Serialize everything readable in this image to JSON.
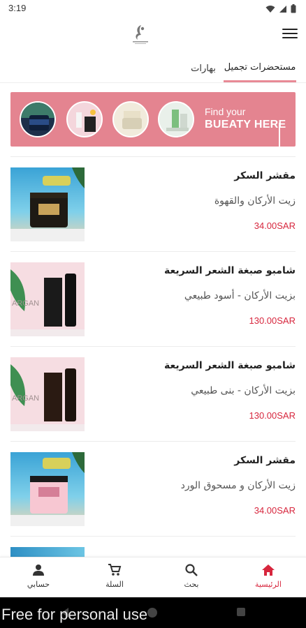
{
  "status_bar": {
    "time": "3:19"
  },
  "header": {
    "logo_icon": "brand-logo-icon",
    "menu_icon": "hamburger-menu-icon"
  },
  "tabs": [
    {
      "label": "مستحضرات تجميل",
      "active": true
    },
    {
      "label": "بهارات",
      "active": false
    }
  ],
  "banner": {
    "line1": "Find your",
    "line2": "BUEATY HERE"
  },
  "products": [
    {
      "name": "مقشر السكر",
      "description": "زيت الأركان والقهوة",
      "price": "34.00SAR"
    },
    {
      "name": "شامبو صبغة الشعر السريعة",
      "description": "بزيت الأركان - أسود طبيعي",
      "price": "130.00SAR"
    },
    {
      "name": "شامبو صبغة الشعر السريعة",
      "description": "بزيت الأركان - بنى طبيعي",
      "price": "130.00SAR"
    },
    {
      "name": "مقشر السكر",
      "description": "زيت الأركان و مسحوق الورد",
      "price": "34.00SAR"
    }
  ],
  "bottom_nav": [
    {
      "label": "الرئيسية",
      "icon": "home-icon",
      "active": true
    },
    {
      "label": "بحث",
      "icon": "search-icon",
      "active": false
    },
    {
      "label": "السلة",
      "icon": "cart-icon",
      "active": false
    },
    {
      "label": "حسابي",
      "icon": "person-icon",
      "active": false
    }
  ],
  "watermark": "Free for personal use",
  "colors": {
    "accent": "#e48490",
    "price": "#d7263d",
    "tab_underline": "#e88a96"
  }
}
